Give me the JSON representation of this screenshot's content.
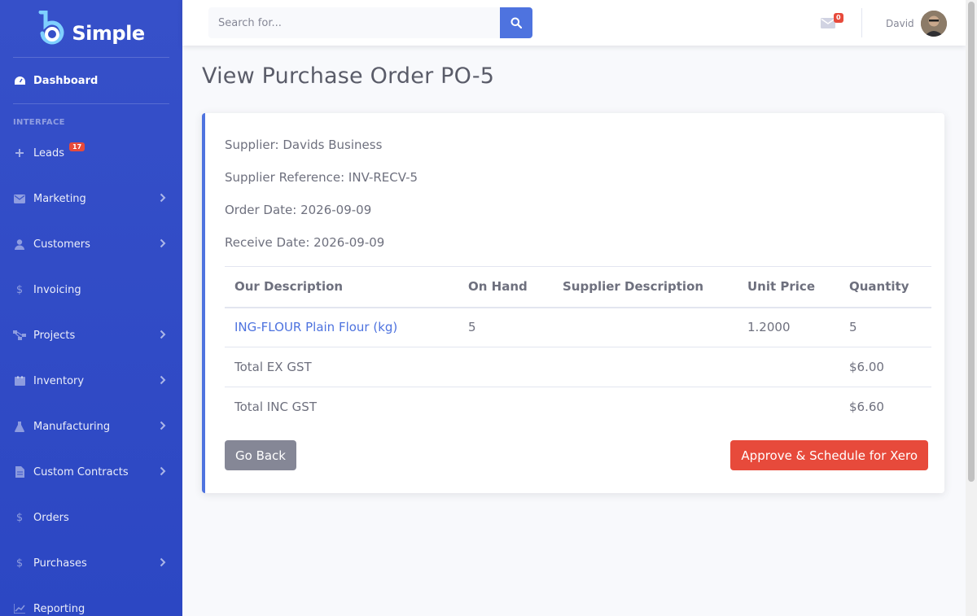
{
  "brand": {
    "name": "Simple"
  },
  "sidebar": {
    "dashboard": "Dashboard",
    "heading": "INTERFACE",
    "leads_badge": "17",
    "items": [
      {
        "label": "Leads",
        "icon": "plus-icon"
      },
      {
        "label": "Marketing",
        "icon": "envelope-icon"
      },
      {
        "label": "Customers",
        "icon": "user-icon"
      },
      {
        "label": "Invoicing",
        "icon": "dollar-icon"
      },
      {
        "label": "Projects",
        "icon": "sitemap-icon"
      },
      {
        "label": "Inventory",
        "icon": "box-icon"
      },
      {
        "label": "Manufacturing",
        "icon": "flask-icon"
      },
      {
        "label": "Custom Contracts",
        "icon": "file-icon"
      },
      {
        "label": "Orders",
        "icon": "dollar-icon"
      },
      {
        "label": "Purchases",
        "icon": "dollar-icon"
      },
      {
        "label": "Reporting",
        "icon": "chart-icon"
      }
    ]
  },
  "topbar": {
    "search_placeholder": "Search for...",
    "messages_count": "0",
    "user_name": "David"
  },
  "page": {
    "title": "View Purchase Order PO-5",
    "supplier": "Supplier: Davids Business",
    "supplier_reference": "Supplier Reference: INV-RECV-5",
    "order_date": "Order Date: 2026-09-09",
    "receive_date": "Receive Date: 2026-09-09"
  },
  "table": {
    "headers": [
      "Our Description",
      "On Hand",
      "Supplier Description",
      "Unit Price",
      "Quantity"
    ],
    "rows": [
      {
        "description": "ING-FLOUR Plain Flour (kg)",
        "on_hand": "5",
        "supplier_description": "",
        "unit_price": "1.2000",
        "quantity": "5"
      }
    ],
    "total_ex_label": "Total EX GST",
    "total_ex_value": "$6.00",
    "total_inc_label": "Total INC GST",
    "total_inc_value": "$6.60"
  },
  "buttons": {
    "back": "Go Back",
    "approve": "Approve & Schedule for Xero"
  },
  "colors": {
    "sidebar": "#3650c9",
    "primary": "#4e73df",
    "danger": "#e74a3b",
    "secondary": "#858796"
  }
}
